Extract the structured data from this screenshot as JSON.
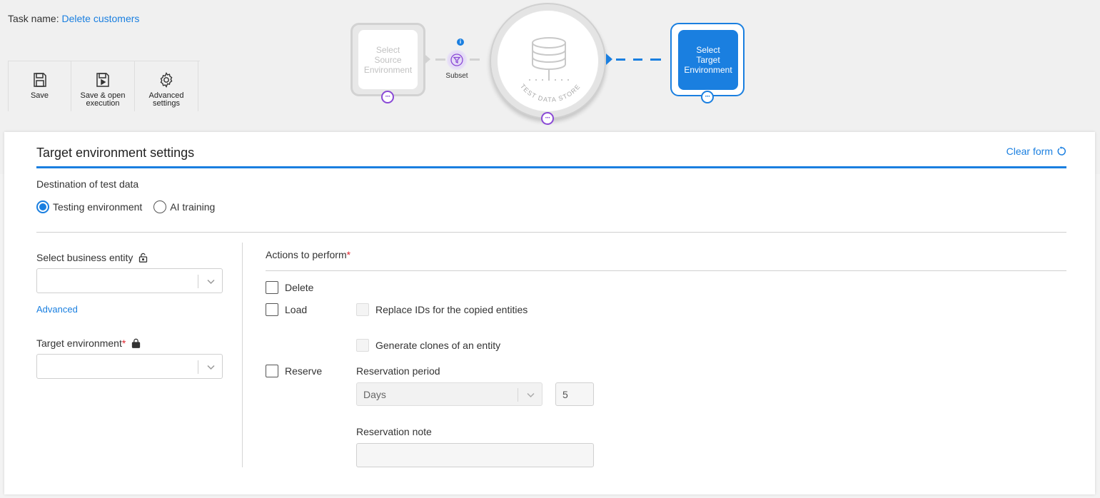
{
  "task": {
    "label": "Task name:",
    "value": "Delete customers"
  },
  "toolbar": {
    "save": "Save",
    "save_open_line1": "Save & open",
    "save_open_line2": "execution",
    "advanced_line1": "Advanced",
    "advanced_line2": "settings"
  },
  "flow": {
    "source_line1": "Select",
    "source_line2": "Source",
    "source_line3": "Environment",
    "subset_label": "Subset",
    "info_badge": "i",
    "store_label": "TEST DATA STORE",
    "target_line1": "Select",
    "target_line2": "Target",
    "target_line3": "Environment",
    "more_dots": "···"
  },
  "panel": {
    "title": "Target environment settings",
    "clear_form": "Clear form",
    "destination_label": "Destination of test data",
    "destination_options": [
      {
        "label": "Testing environment",
        "checked": true
      },
      {
        "label": "AI training",
        "checked": false
      }
    ],
    "business_entity_label": "Select business entity",
    "advanced_link": "Advanced",
    "target_env_label": "Target environment",
    "required_mark": "*",
    "actions_label": "Actions to perform",
    "actions": {
      "delete": "Delete",
      "load": "Load",
      "replace_ids": "Replace IDs for the copied entities",
      "generate_clones": "Generate clones of an entity",
      "reserve": "Reserve",
      "reservation_period_label": "Reservation period",
      "reservation_period_unit": "Days",
      "reservation_period_value": "5",
      "reservation_note_label": "Reservation note"
    }
  },
  "colors": {
    "accent": "#1a7fe0",
    "purple": "#8a49d6",
    "required": "#e0242e"
  }
}
